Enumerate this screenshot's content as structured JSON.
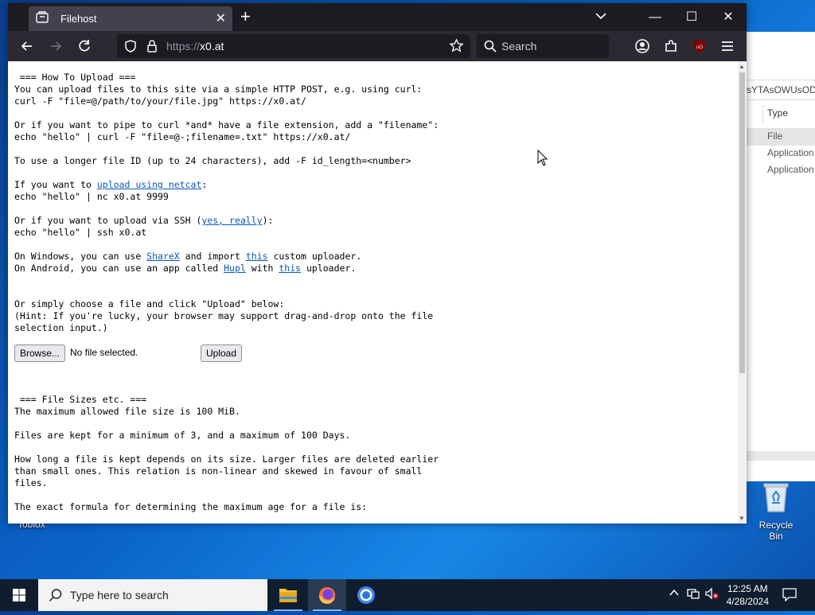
{
  "browser": {
    "tab_title": "Filehost",
    "url_scheme": "https://",
    "url_host": "x0.at",
    "search_placeholder": "Search"
  },
  "page": {
    "upload_heading": " === How To Upload ===",
    "line1": "You can upload files to this site via a simple HTTP POST, e.g. using curl:",
    "line2": "curl -F \"file=@/path/to/your/file.jpg\" https://x0.at/",
    "line3": "Or if you want to pipe to curl *and* have a file extension, add a \"filename\":",
    "line4": "echo \"hello\" | curl -F \"file=@-;filename=.txt\" https://x0.at/",
    "line5": "To use a longer file ID (up to 24 characters), add -F id_length=<number>",
    "netcat_prefix": "If you want to ",
    "netcat_link": "upload using netcat",
    "netcat_suffix": ":",
    "line6": "echo \"hello\" | nc x0.at 9999",
    "ssh_prefix": "Or if you want to upload via SSH (",
    "ssh_link": "yes, really",
    "ssh_suffix": "):",
    "line7": "echo \"hello\" | ssh x0.at",
    "win_prefix": "On Windows, you can use ",
    "sharex_link": "ShareX",
    "win_mid": " and import ",
    "this_link_1": "this",
    "win_suffix": " custom uploader.",
    "android_prefix": "On Android, you can use an app called ",
    "hupl_link": "Hupl",
    "android_mid": " with ",
    "this_link_2": "this",
    "android_suffix": " uploader.",
    "line8": "Or simply choose a file and click \"Upload\" below:",
    "line9": "(Hint: If you're lucky, your browser may support drag-and-drop onto the file",
    "line10": "selection input.)",
    "browse_label": "Browse...",
    "no_file_label": "No file selected.",
    "upload_label": "Upload",
    "sizes_heading": " === File Sizes etc. ===",
    "line11": "The maximum allowed file size is 100 MiB.",
    "line12": "Files are kept for a minimum of 3, and a maximum of 100 Days.",
    "line13": "How long a file is kept depends on its size. Larger files are deleted earlier",
    "line14": "than small ones. This relation is non-linear and skewed in favour of small",
    "line15": "files.",
    "line16": "The exact formula for determining the maximum age for a file is:"
  },
  "background_window": {
    "address_fragment": "sYTAsOWUsODY",
    "column_header": "Type",
    "rows": [
      "File",
      "Application",
      "Application"
    ]
  },
  "desktop": {
    "recycle_bin_label": "Recycle Bin",
    "partial_label": "Toblox"
  },
  "taskbar": {
    "search_placeholder": "Type here to search",
    "time": "12:25 AM",
    "date": "4/28/2024"
  },
  "colors": {
    "link": "#0b57b7",
    "browser_dark": "#2b2a33",
    "taskbar": "#101d2e"
  }
}
